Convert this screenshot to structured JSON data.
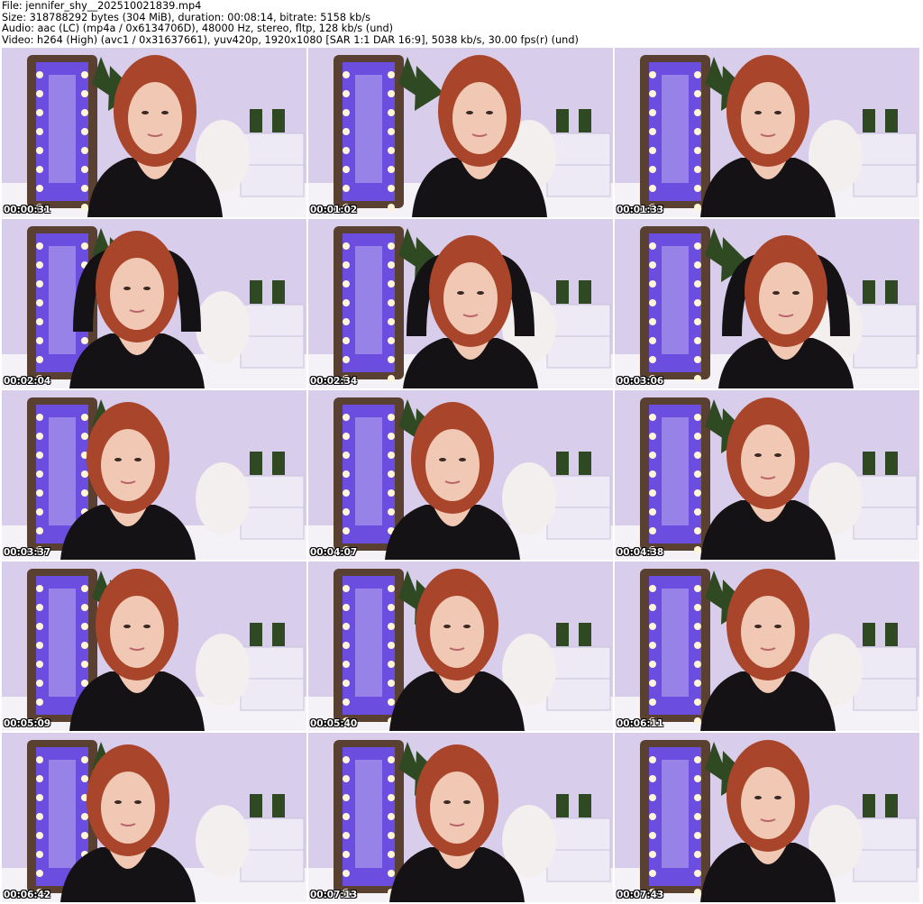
{
  "header": {
    "file": "File: jennifer_shy__202510021839.mp4",
    "size": "Size: 318788292 bytes (304 MiB), duration: 00:08:14, bitrate: 5158 kb/s",
    "audio": "Audio: aac (LC) (mp4a / 0x6134706D), 48000 Hz, stereo, fltp, 128 kb/s (und)",
    "video": "Video: h264 (High) (avc1 / 0x31637661), yuv420p, 1920x1080 [SAR 1:1 DAR 16:9], 5038 kb/s, 30.00 fps(r) (und)"
  },
  "thumbnails": [
    {
      "time": "00:00:31"
    },
    {
      "time": "00:01:02"
    },
    {
      "time": "00:01:33"
    },
    {
      "time": "00:02:04"
    },
    {
      "time": "00:02:34"
    },
    {
      "time": "00:03:06"
    },
    {
      "time": "00:03:37"
    },
    {
      "time": "00:04:07"
    },
    {
      "time": "00:04:38"
    },
    {
      "time": "00:05:09"
    },
    {
      "time": "00:05:40"
    },
    {
      "time": "00:06:11"
    },
    {
      "time": "00:06:42"
    },
    {
      "time": "00:07:13"
    },
    {
      "time": "00:07:43"
    }
  ],
  "colors": {
    "wall": "#d8cdea",
    "mirror_glow": "#6b4ee0",
    "mirror_frame": "#5a4030",
    "hair": "#a8452a",
    "skin": "#f0c8b4",
    "outfit": "#141214",
    "plant": "#2f4a22",
    "drawer": "#eeeaf5",
    "rug": "#f4f2f6",
    "bulb": "#fff6da"
  }
}
